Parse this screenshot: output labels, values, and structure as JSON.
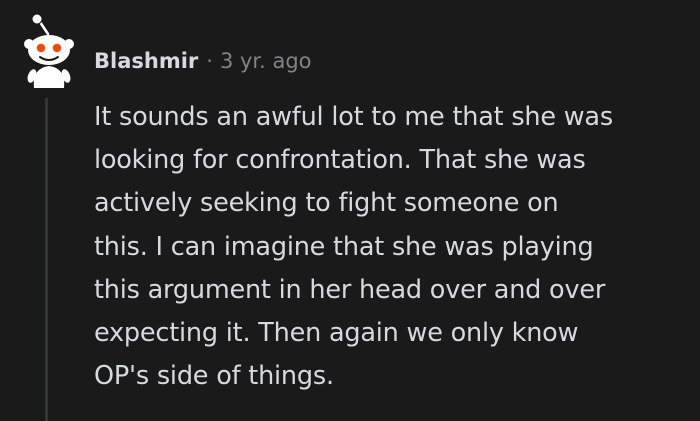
{
  "comment": {
    "author": "Blashmir",
    "separator": "·",
    "timestamp": "3 yr. ago",
    "avatar_icon": "snoo-avatar-icon",
    "body_lines": [
      "It sounds an awful lot to me that she was",
      "looking for confrontation. That she was",
      "actively seeking to fight someone on",
      "this. I can imagine that she was playing",
      "this argument in her head over and over",
      "expecting it. Then again we only know",
      "OP's side of things."
    ]
  },
  "colors": {
    "background": "#1a1a1b",
    "text": "#d7dadc",
    "muted": "#818384",
    "thread_line": "#343536",
    "avatar_eye": "#ff4500"
  }
}
